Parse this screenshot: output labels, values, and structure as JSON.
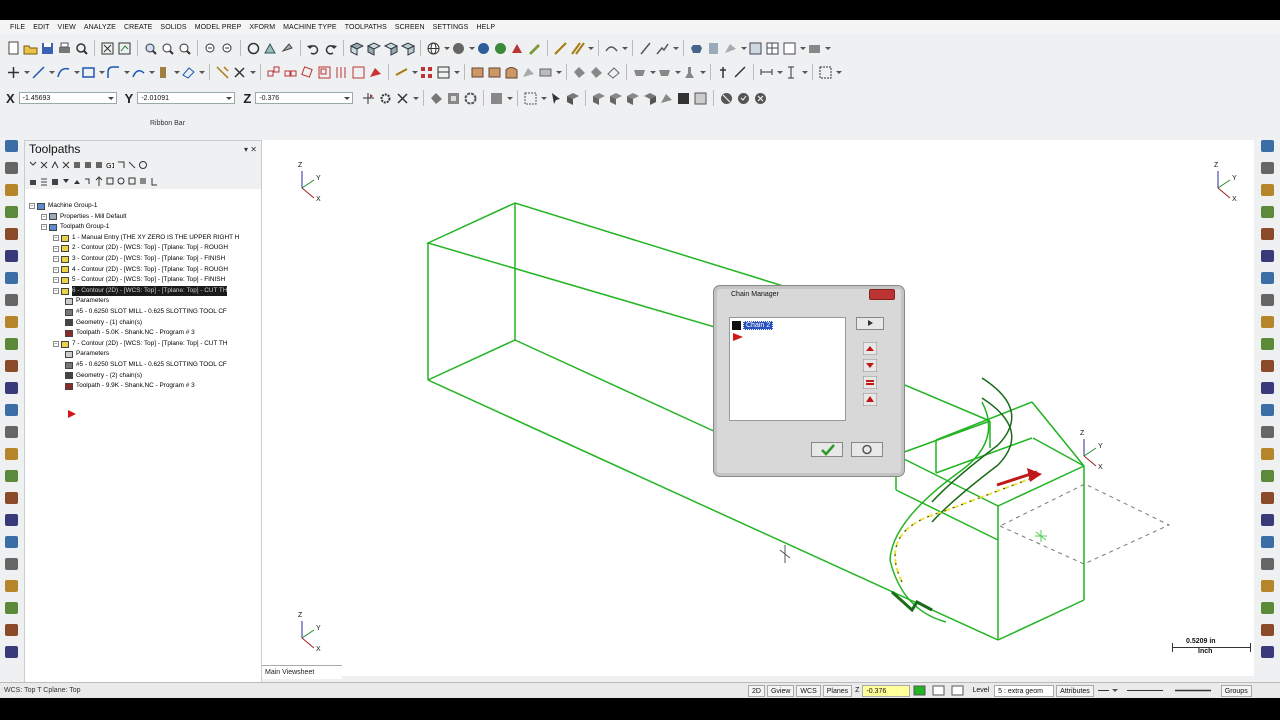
{
  "menu": [
    "FILE",
    "EDIT",
    "VIEW",
    "ANALYZE",
    "CREATE",
    "SOLIDS",
    "MODEL PREP",
    "XFORM",
    "MACHINE TYPE",
    "TOOLPATHS",
    "SCREEN",
    "SETTINGS",
    "HELP"
  ],
  "coords": {
    "x_label": "X",
    "x_value": "-1.45693",
    "y_label": "Y",
    "y_value": "-2.01091",
    "z_label": "Z",
    "z_value": "-0.376"
  },
  "ribbon_label": "Ribbon Bar",
  "toolpaths": {
    "title": "Toolpaths",
    "pin": "▾ ✕",
    "tree": [
      {
        "text": "Machine Group-1",
        "indent": 0,
        "icon": "group"
      },
      {
        "text": "Properties - Mill Default",
        "indent": 1,
        "icon": "props"
      },
      {
        "text": "Toolpath Group-1",
        "indent": 1,
        "icon": "group"
      },
      {
        "text": "1 - Manual Entry (THE XY ZERO IS THE UPPER RIGHT H",
        "indent": 2,
        "icon": "folder"
      },
      {
        "text": "2 - Contour (2D) - [WCS: Top] - [Tplane: Top] - ROUGH",
        "indent": 2,
        "icon": "folder"
      },
      {
        "text": "3 - Contour (2D) - [WCS: Top] - [Tplane: Top] - FINISH",
        "indent": 2,
        "icon": "folder"
      },
      {
        "text": "4 - Contour (2D) - [WCS: Top] - [Tplane: Top] - ROUGH",
        "indent": 2,
        "icon": "folder"
      },
      {
        "text": "5 - Contour (2D) - [WCS: Top] - [Tplane: Top] - FINISH",
        "indent": 2,
        "icon": "folder"
      },
      {
        "text": "6 - Contour (2D) - [WCS: Top] - [Tplane: Top] - CUT TH",
        "indent": 2,
        "icon": "folder",
        "selected": true
      },
      {
        "text": "Parameters",
        "indent": 3,
        "icon": "params"
      },
      {
        "text": "#5 - 0.6250 SLOT MILL - 0.625 SLOTTING TOOL CF",
        "indent": 3,
        "icon": "tool"
      },
      {
        "text": "Geometry - (1) chain(s)",
        "indent": 3,
        "icon": "geom"
      },
      {
        "text": "Toolpath - 5.0K - Shank.NC - Program # 3",
        "indent": 3,
        "icon": "tp"
      },
      {
        "text": "7 - Contour (2D) - [WCS: Top] - [Tplane: Top] - CUT TH",
        "indent": 2,
        "icon": "folder"
      },
      {
        "text": "Parameters",
        "indent": 3,
        "icon": "params"
      },
      {
        "text": "#5 - 0.6250 SLOT MILL - 0.625 SLOTTING TOOL CF",
        "indent": 3,
        "icon": "tool"
      },
      {
        "text": "Geometry - (2) chain(s)",
        "indent": 3,
        "icon": "geom"
      },
      {
        "text": "Toolpath - 9.9K - Shank.NC - Program # 3",
        "indent": 3,
        "icon": "tp"
      }
    ]
  },
  "chain_manager": {
    "title": "Chain Manager",
    "chain_item": "Chain 2"
  },
  "viewport": {
    "tab": "Main Viewsheet",
    "scale_value": "0.5209 in",
    "scale_unit": "Inch",
    "axis_z": "Z",
    "axis_y": "Y",
    "axis_x": "X"
  },
  "status": {
    "left": "WCS: Top  T Cplane: Top",
    "b2d": "2D",
    "gview": "Gview",
    "wcs": "WCS",
    "planes": "Planes",
    "z_label": "Z",
    "z_value": "-0.376",
    "level_label": "Level",
    "level_value": "5 : extra geom",
    "attributes": "Attributes",
    "groups": "Groups"
  },
  "colors": {
    "geometry_green": "#22b422",
    "chain_yellow": "#e8e23a",
    "arrow_red": "#c01818",
    "selection_blue": "#2a52be"
  }
}
